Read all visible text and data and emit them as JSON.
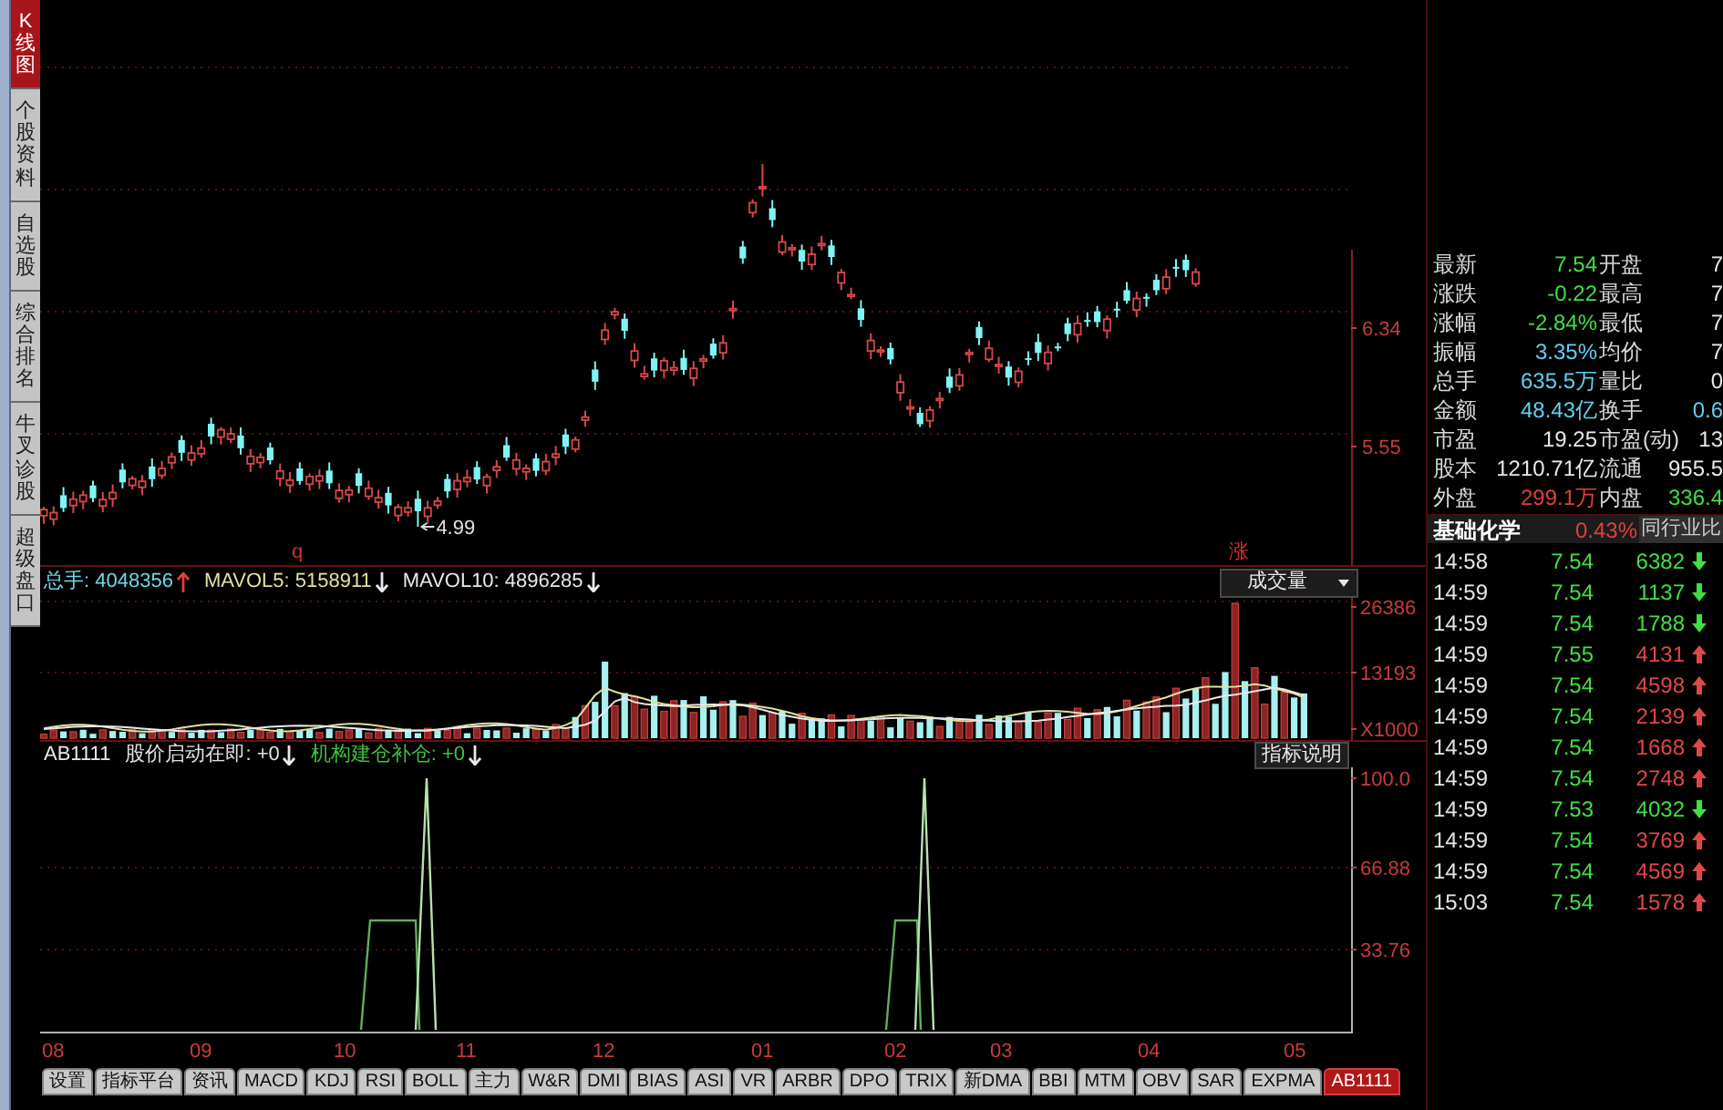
{
  "sidebar": {
    "tabs": [
      {
        "label": "K线图",
        "selected": true
      },
      {
        "label": "个股资料",
        "selected": false
      },
      {
        "label": "自选股",
        "selected": false
      },
      {
        "label": "综合排名",
        "selected": false
      },
      {
        "label": "牛叉诊股",
        "selected": false
      },
      {
        "label": "超级盘口",
        "selected": false
      }
    ]
  },
  "price_chart": {
    "axis_labels": [
      "6.34",
      "5.55"
    ],
    "low_label": "4.99",
    "markers": [
      "q",
      "涨"
    ]
  },
  "volume_panel": {
    "stats": [
      {
        "text": "总手: 4048356",
        "rising": true,
        "color": "#6fd8e8"
      },
      {
        "text": "MAVOL5: 5158911",
        "rising": false,
        "color": "#e0e0a0"
      },
      {
        "text": "MAVOL10: 4896285",
        "rising": false,
        "color": "#e8e8e8"
      }
    ],
    "selector": {
      "value": "成交量"
    },
    "axis_labels": [
      "26386",
      "13193",
      "X1000"
    ]
  },
  "indicator_panel": {
    "name": "AB1111",
    "signals": [
      {
        "text": "股价启动在即: +0",
        "rising": false,
        "color": "#e0e0e0"
      },
      {
        "text": "机构建仓补仓: +0",
        "rising": false,
        "color": "#40c040"
      }
    ],
    "help_button": "指标说明",
    "axis_labels": [
      "100.0",
      "66.88",
      "33.76"
    ]
  },
  "months": [
    "08",
    "09",
    "10",
    "11",
    "12",
    "01",
    "02",
    "03",
    "04",
    "05"
  ],
  "indicator_tabs": [
    {
      "label": "设置",
      "selected": false
    },
    {
      "label": "指标平台",
      "selected": false
    },
    {
      "label": "资讯",
      "selected": false
    },
    {
      "label": "MACD",
      "selected": false
    },
    {
      "label": "KDJ",
      "selected": false
    },
    {
      "label": "RSI",
      "selected": false
    },
    {
      "label": "BOLL",
      "selected": false
    },
    {
      "label": "主力",
      "selected": false
    },
    {
      "label": "W&R",
      "selected": false
    },
    {
      "label": "DMI",
      "selected": false
    },
    {
      "label": "BIAS",
      "selected": false
    },
    {
      "label": "ASI",
      "selected": false
    },
    {
      "label": "VR",
      "selected": false
    },
    {
      "label": "ARBR",
      "selected": false
    },
    {
      "label": "DPO",
      "selected": false
    },
    {
      "label": "TRIX",
      "selected": false
    },
    {
      "label": "新DMA",
      "selected": false
    },
    {
      "label": "BBI",
      "selected": false
    },
    {
      "label": "MTM",
      "selected": false
    },
    {
      "label": "OBV",
      "selected": false
    },
    {
      "label": "SAR",
      "selected": false
    },
    {
      "label": "EXPMA",
      "selected": false
    },
    {
      "label": "AB1111",
      "selected": true
    }
  ],
  "quote": {
    "rows": [
      {
        "left": {
          "label": "最新",
          "value": "7.54",
          "color": "#40e040"
        },
        "right": {
          "label": "开盘",
          "value": "7",
          "color": "#e8e8e8"
        }
      },
      {
        "left": {
          "label": "涨跌",
          "value": "-0.22",
          "color": "#40e040"
        },
        "right": {
          "label": "最高",
          "value": "7",
          "color": "#e8e8e8"
        }
      },
      {
        "left": {
          "label": "涨幅",
          "value": "-2.84%",
          "color": "#40e040"
        },
        "right": {
          "label": "最低",
          "value": "7",
          "color": "#e8e8e8"
        }
      },
      {
        "left": {
          "label": "振幅",
          "value": "3.35%",
          "color": "#60d0f0"
        },
        "right": {
          "label": "均价",
          "value": "7",
          "color": "#e8e8e8"
        }
      },
      {
        "left": {
          "label": "总手",
          "value": "635.5万",
          "color": "#60d0f0"
        },
        "right": {
          "label": "量比",
          "value": "0",
          "color": "#e8e8e8"
        }
      },
      {
        "left": {
          "label": "金额",
          "value": "48.43亿",
          "color": "#60d0f0"
        },
        "right": {
          "label": "换手",
          "value": "0.6",
          "color": "#60d0f0"
        }
      },
      {
        "left": {
          "label": "市盈",
          "value": "19.25",
          "color": "#e8e8e8"
        },
        "right": {
          "label": "市盈(动)",
          "value": "13",
          "color": "#e8e8e8"
        }
      },
      {
        "left": {
          "label": "股本",
          "value": "1210.71亿",
          "color": "#e8e8e8"
        },
        "right": {
          "label": "流通",
          "value": "955.5",
          "color": "#e8e8e8"
        }
      },
      {
        "left": {
          "label": "外盘",
          "value": "299.1万",
          "color": "#e04040"
        },
        "right": {
          "label": "内盘",
          "value": "336.4",
          "color": "#40e040"
        }
      }
    ]
  },
  "industry": {
    "name": "基础化学",
    "change": "0.43%",
    "compare_button": "同行业比"
  },
  "trades": [
    {
      "time": "14:58",
      "price": "7.54",
      "volume": "6382",
      "rising": false
    },
    {
      "time": "14:59",
      "price": "7.54",
      "volume": "1137",
      "rising": false
    },
    {
      "time": "14:59",
      "price": "7.54",
      "volume": "1788",
      "rising": false
    },
    {
      "time": "14:59",
      "price": "7.55",
      "volume": "4131",
      "rising": true
    },
    {
      "time": "14:59",
      "price": "7.54",
      "volume": "4598",
      "rising": true
    },
    {
      "time": "14:59",
      "price": "7.54",
      "volume": "2139",
      "rising": true
    },
    {
      "time": "14:59",
      "price": "7.54",
      "volume": "1668",
      "rising": true
    },
    {
      "time": "14:59",
      "price": "7.54",
      "volume": "2748",
      "rising": true
    },
    {
      "time": "14:59",
      "price": "7.53",
      "volume": "4032",
      "rising": false
    },
    {
      "time": "14:59",
      "price": "7.54",
      "volume": "3769",
      "rising": true
    },
    {
      "time": "14:59",
      "price": "7.54",
      "volume": "4569",
      "rising": true
    },
    {
      "time": "15:03",
      "price": "7.54",
      "volume": "1578",
      "rising": true
    }
  ]
}
